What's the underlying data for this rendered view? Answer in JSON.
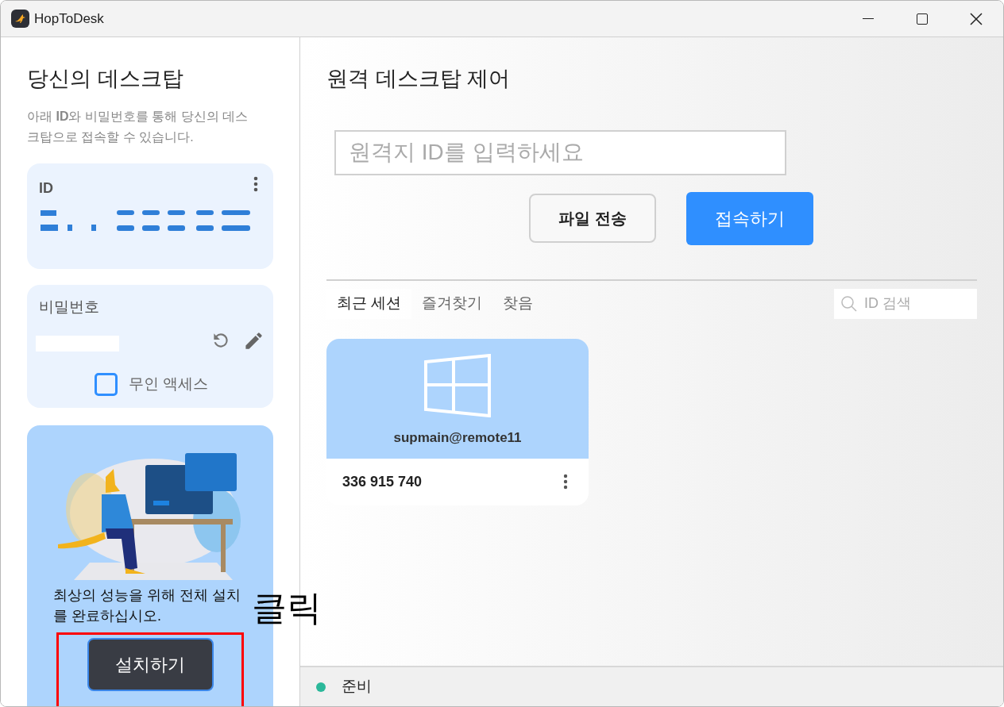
{
  "window": {
    "title": "HopToDesk"
  },
  "local": {
    "heading": "당신의 데스크탑",
    "description": "아래 **ID**와 비밀번호를 통해 당신의 데스크탑으로 접속할 수 있습니다.",
    "id_label": "ID",
    "password_label": "비밀번호",
    "unattended": {
      "label": "무인 액세스",
      "checked": false
    }
  },
  "promo": {
    "text": "최상의 성능을 위해 전체 설치를 완료하십시오.",
    "button": "설치하기"
  },
  "annotation": {
    "text": "클릭"
  },
  "remote": {
    "heading": "원격 데스크탑 제어",
    "id_field": {
      "placeholder": "원격지 ID를 입력하세요"
    },
    "buttons": [
      {
        "label": "파일 전송",
        "kind": "secondary"
      },
      {
        "label": "접속하기",
        "kind": "primary"
      }
    ]
  },
  "tabs": [
    {
      "label": "최근 세션",
      "selected": true
    },
    {
      "label": "즐겨찾기",
      "selected": false
    },
    {
      "label": "찾음",
      "selected": false
    }
  ],
  "search": {
    "placeholder": "ID 검색"
  },
  "sessions": [
    {
      "name": "supmain@remote11",
      "id": "336 915 740"
    }
  ],
  "status_bar": {
    "text": "준비",
    "color": "#2bb89a"
  }
}
